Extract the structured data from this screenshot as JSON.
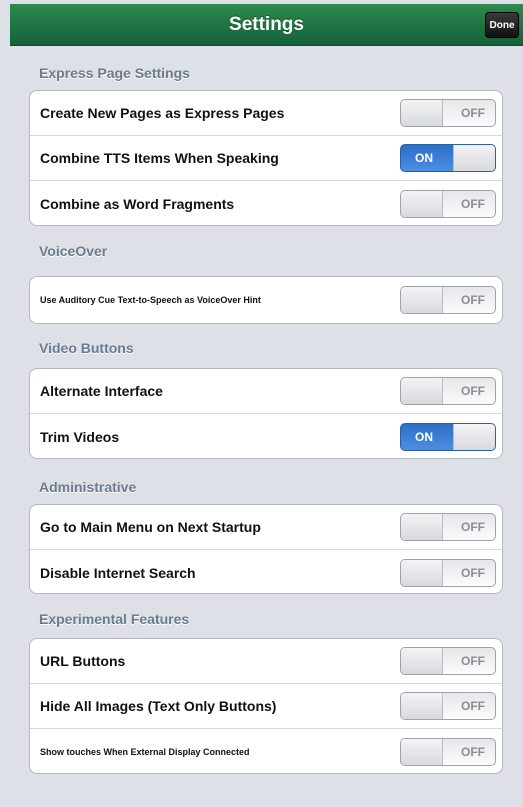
{
  "navbar": {
    "title": "Settings",
    "done_label": "Done"
  },
  "colors": {
    "nav_green": "#1f7445",
    "switch_on_blue": "#3b7fd8",
    "header_gray": "#6c7a8d"
  },
  "sections": [
    {
      "header": "Express Page Settings",
      "rows": [
        {
          "label": "Create New Pages as Express Pages",
          "state": "OFF"
        },
        {
          "label": "Combine TTS Items When Speaking",
          "state": "ON"
        },
        {
          "label": "Combine as Word Fragments",
          "state": "OFF"
        }
      ]
    },
    {
      "header": "VoiceOver",
      "rows": [
        {
          "label": "Use Auditory Cue Text-to-Speech as VoiceOver Hint",
          "state": "OFF"
        }
      ]
    },
    {
      "header": "Video Buttons",
      "rows": [
        {
          "label": "Alternate Interface",
          "state": "OFF"
        },
        {
          "label": "Trim Videos",
          "state": "ON"
        }
      ]
    },
    {
      "header": "Administrative",
      "rows": [
        {
          "label": "Go to Main Menu on Next Startup",
          "state": "OFF"
        },
        {
          "label": "Disable Internet Search",
          "state": "OFF"
        }
      ]
    },
    {
      "header": "Experimental Features",
      "rows": [
        {
          "label": "URL Buttons",
          "state": "OFF"
        },
        {
          "label": "Hide All Images (Text Only Buttons)",
          "state": "OFF"
        },
        {
          "label": "Show touches When External Display Connected",
          "state": "OFF"
        }
      ]
    }
  ]
}
